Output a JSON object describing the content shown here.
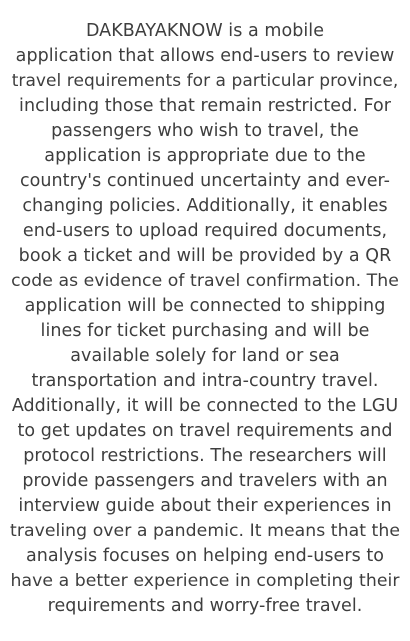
{
  "description": {
    "lines": [
      "DAKBAYAKNOW is a mobile",
      "application that allows end-users to review",
      "travel requirements for a particular province,",
      "including those that remain restricted. For",
      "passengers who wish to travel, the",
      "application is appropriate due to the",
      "country's continued uncertainty and ever-",
      "changing policies. Additionally, it enables",
      "end-users to upload required documents,",
      "book a ticket and will be provided by a QR",
      "code as evidence of travel confirmation. The",
      "application will be connected to shipping",
      "lines for ticket purchasing and will be",
      "available solely for land or sea",
      "transportation and intra-country travel.",
      "Additionally, it will be connected to the LGU",
      "to get updates on travel requirements and",
      "protocol restrictions. The researchers will",
      "provide passengers and travelers with an",
      "interview guide about their experiences in",
      "traveling over a pandemic. It means that the",
      "analysis focuses on helping end-users to",
      "have a better experience in completing their",
      "requirements and worry-free travel."
    ]
  },
  "colors": {
    "text": "#3e3e3e",
    "background": "#ffffff"
  }
}
